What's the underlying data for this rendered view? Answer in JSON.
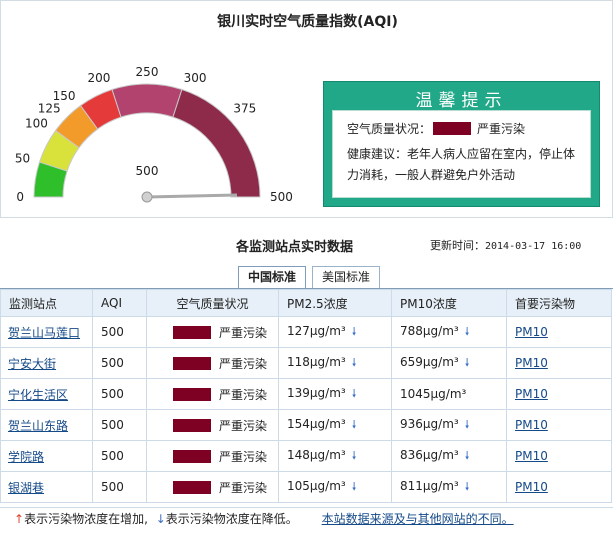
{
  "title": "银川实时空气质量指数(AQI)",
  "gauge": {
    "value": 500,
    "value_label": "500",
    "min": 0,
    "max": 500,
    "ticks": [
      "0",
      "50",
      "100",
      "125",
      "150",
      "200",
      "250",
      "300",
      "375",
      "500"
    ],
    "tick_values": [
      0,
      50,
      100,
      125,
      150,
      200,
      250,
      300,
      375,
      500
    ],
    "band_colors": [
      "#2fbf2a",
      "#d9e23a",
      "#f39b2a",
      "#e43a3a",
      "#b2426e",
      "#8e2a4a"
    ]
  },
  "tip": {
    "header": "温馨提示",
    "status_label": "空气质量状况：",
    "status_value": "严重污染",
    "status_color": "#7e0023",
    "advice": "健康建议：老年人病人应留在室内，停止体力消耗，一般人群避免户外活动"
  },
  "section": {
    "title": "各监测站点实时数据",
    "update_label": "更新时间：",
    "update_time": "2014-03-17 16:00"
  },
  "tabs": [
    {
      "label": "中国标准",
      "active": true
    },
    {
      "label": "美国标准",
      "active": false
    }
  ],
  "table": {
    "columns": [
      "监测站点",
      "AQI",
      "空气质量状况",
      "PM2.5浓度",
      "PM10浓度",
      "首要污染物"
    ],
    "rows": [
      {
        "station": "贺兰山马莲口",
        "aqi": "500",
        "status": "严重污染",
        "pm25": "127μg/m³",
        "pm25_trend": "down",
        "pm10": "788μg/m³",
        "pm10_trend": "down",
        "pollutant": "PM10"
      },
      {
        "station": "宁安大街",
        "aqi": "500",
        "status": "严重污染",
        "pm25": "118μg/m³",
        "pm25_trend": "down",
        "pm10": "659μg/m³",
        "pm10_trend": "down",
        "pollutant": "PM10"
      },
      {
        "station": "宁化生活区",
        "aqi": "500",
        "status": "严重污染",
        "pm25": "139μg/m³",
        "pm25_trend": "down",
        "pm10": "1045μg/m³",
        "pm10_trend": "",
        "pollutant": "PM10"
      },
      {
        "station": "贺兰山东路",
        "aqi": "500",
        "status": "严重污染",
        "pm25": "154μg/m³",
        "pm25_trend": "down",
        "pm10": "936μg/m³",
        "pm10_trend": "down",
        "pollutant": "PM10"
      },
      {
        "station": "学院路",
        "aqi": "500",
        "status": "严重污染",
        "pm25": "148μg/m³",
        "pm25_trend": "down",
        "pm10": "836μg/m³",
        "pm10_trend": "down",
        "pollutant": "PM10"
      },
      {
        "station": "银湖巷",
        "aqi": "500",
        "status": "严重污染",
        "pm25": "105μg/m³",
        "pm25_trend": "down",
        "pm10": "811μg/m³",
        "pm10_trend": "down",
        "pollutant": "PM10"
      }
    ]
  },
  "footer": {
    "up_arrow": "↑",
    "up_text": "表示污染物浓度在增加,",
    "down_arrow": "↓",
    "down_text": "表示污染物浓度在降低。",
    "link_text": "本站数据来源及与其他网站的不同。"
  },
  "icons": {
    "trend_down": "arrow-down-icon",
    "trend_up": "arrow-up-icon"
  }
}
